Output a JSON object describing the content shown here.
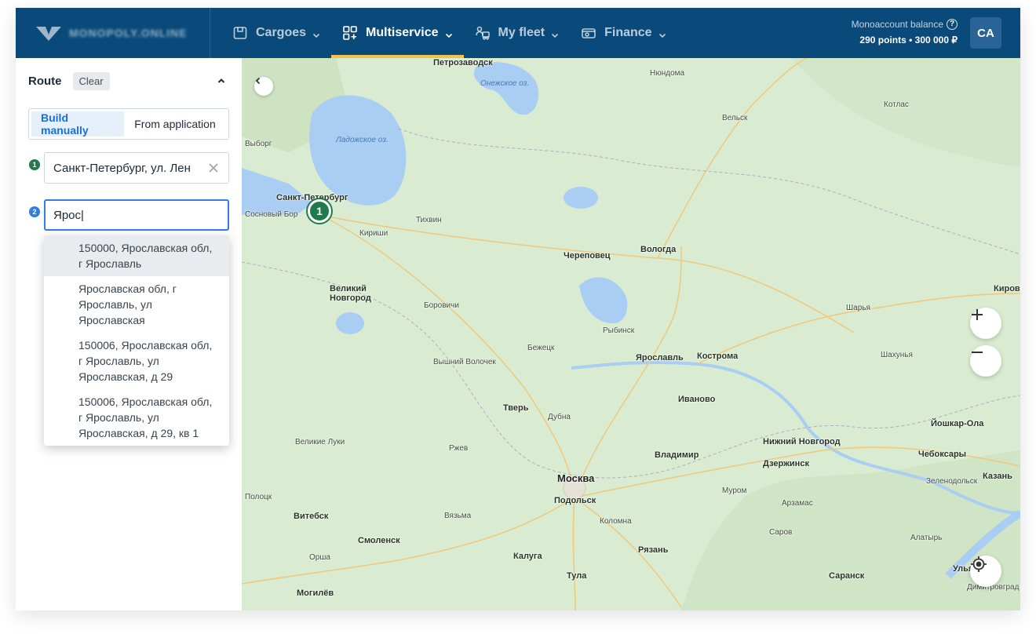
{
  "header": {
    "logo_text": "MONOPOLY.ONLINE",
    "nav": [
      {
        "label": "Cargoes",
        "icon": "box-icon"
      },
      {
        "label": "Multiservice",
        "icon": "grid-plus-icon"
      },
      {
        "label": "My fleet",
        "icon": "truck-people-icon"
      },
      {
        "label": "Finance",
        "icon": "wallet-icon"
      }
    ],
    "active_nav": "Multiservice",
    "balance_label": "Monoaccount balance",
    "balance_value": "290 points • 300 000 ₽",
    "avatar": "CA"
  },
  "sidebar": {
    "title": "Route",
    "clear_label": "Clear",
    "mode_options": [
      "Build manually",
      "From application"
    ],
    "selected_mode": "Build manually",
    "points": [
      {
        "number": "1",
        "value": "Санкт-Петербург, ул. Лен",
        "color": "#1f7a4d"
      },
      {
        "number": "2",
        "value": "Ярос|",
        "color": "#2f7ee0"
      }
    ],
    "suggestions": [
      "150000, Ярославская обл, г Ярославль",
      "Ярославская обл, г Ярославль, ул Ярославская",
      "150006, Ярославская обл, г Ярославль, ул Ярославская, д 29",
      "150006, Ярославская обл, г Ярославль, ул Ярославская, д 29, кв 1"
    ]
  },
  "map": {
    "marker_label": "1",
    "zoom_in": "+",
    "zoom_out": "−",
    "lakes": [
      "Ладожское оз.",
      "Онежское оз."
    ],
    "cities": [
      "Петрозаводск",
      "Нюндома",
      "Котлас",
      "Вельск",
      "Выборг",
      "Санкт-Петербург",
      "Сосновый Бор",
      "Тихвин",
      "Кириши",
      "Череповец",
      "Вологда",
      "Великий Новгород",
      "Боровичи",
      "Рыбинск",
      "Шарья",
      "Киров",
      "Бежецк",
      "Вышний Волочек",
      "Ярославль",
      "Кострома",
      "Шахунья",
      "Тверь",
      "Дубна",
      "Иваново",
      "Йошкар-Ола",
      "Великие Луки",
      "Ржев",
      "Владимир",
      "Нижний Новгород",
      "Чебоксары",
      "Дзержинск",
      "Москва",
      "Подольск",
      "Зеленодольск",
      "Казань",
      "Полоцк",
      "Муром",
      "Арзамас",
      "Витебск",
      "Вязьма",
      "Коломна",
      "Саров",
      "Смоленск",
      "Алатырь",
      "Орша",
      "Калуга",
      "Рязань",
      "Ульяновск",
      "Тула",
      "Саранск",
      "Могилёв",
      "Димитровград"
    ]
  }
}
